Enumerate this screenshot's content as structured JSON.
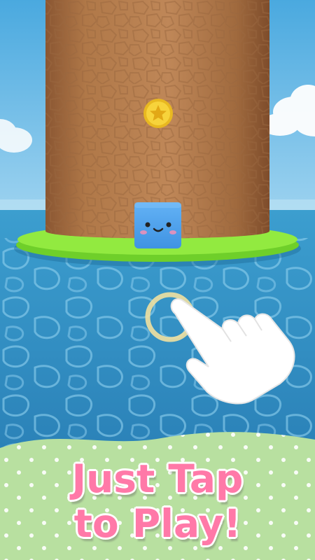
{
  "tagline": {
    "line1": "Just Tap",
    "line2": "to Play!"
  },
  "colors": {
    "sky": "#5fb7e6",
    "tower": "#b37a4c",
    "platform": "#8ee83a",
    "water": "#2f8fc2",
    "player_cube": "#4fa3ef",
    "coin": "#f7d33b",
    "banner_bg": "#b8e0a0",
    "tagline_text": "#ff79a8"
  },
  "scene": {
    "player": "smiling-blue-cube",
    "collectible": "star-coin",
    "hint": "tap-hand-icon"
  }
}
